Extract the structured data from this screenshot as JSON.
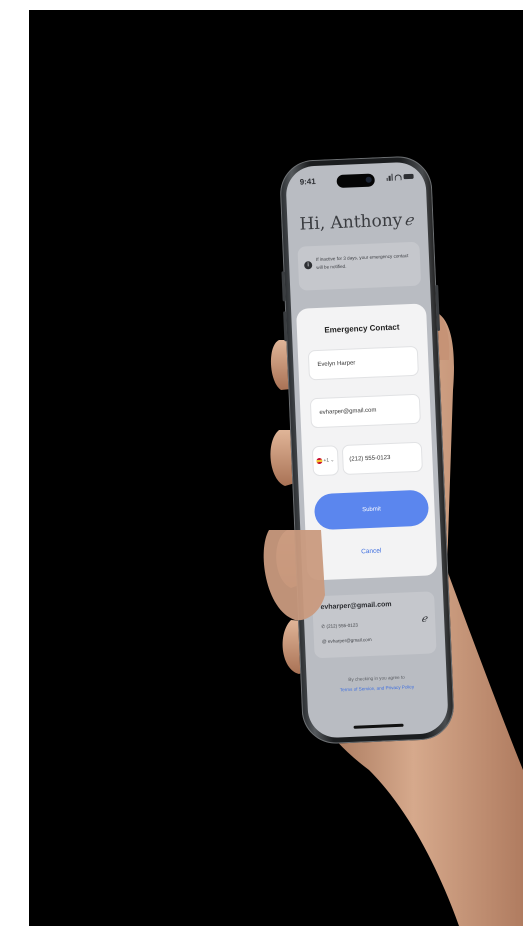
{
  "status_bar": {
    "time": "9:41"
  },
  "greeting": {
    "text": "Hi, Anthony",
    "edit_glyph": "ℯ"
  },
  "notice": {
    "text": "If inactive for 3 days, your emergency contact will be notified."
  },
  "modal": {
    "title": "Emergency Contact",
    "name_value": "Evelyn Harper",
    "email_value": "evharper@gmail.com",
    "country_code": "+1",
    "phone_value": "(212) 555-0123",
    "submit_label": "Submit",
    "cancel_label": "Cancel"
  },
  "contact_card": {
    "name": "evharper@gmail.com",
    "phone": "(212) 555-0123",
    "email": "evharper@gmail.com",
    "edit_glyph": "ℯ"
  },
  "terms": {
    "prefix": "By checking in you agree to",
    "link": "Terms of Service, and Privacy Policy"
  },
  "colors": {
    "accent": "#5b86ee",
    "link": "#3f6fe0",
    "background": "#000000"
  }
}
